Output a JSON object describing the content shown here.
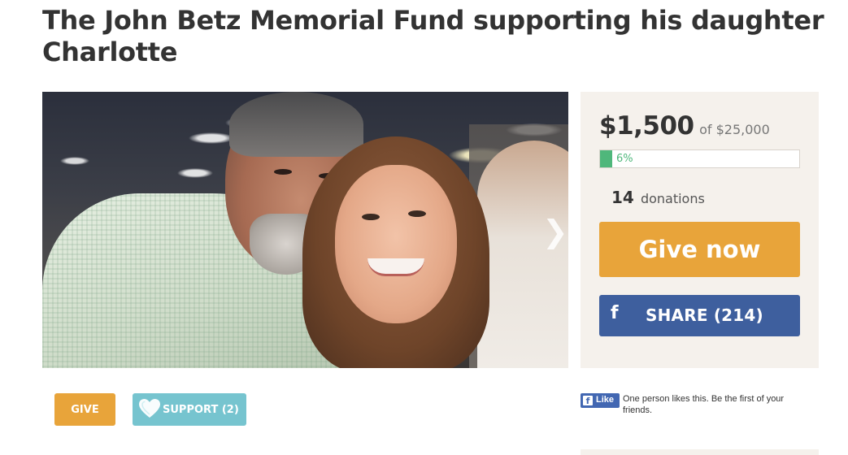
{
  "campaign": {
    "title": "The John Betz Memorial Fund supporting his daughter Charlotte"
  },
  "photo": {
    "next_arrow": "❯"
  },
  "donation_panel": {
    "raised": "$1,500",
    "goal": "of $25,000",
    "progress_percent": 6,
    "progress_label": "6%",
    "donations_count": "14",
    "donations_label": "donations",
    "give_now_label": "Give now",
    "share_icon": "f",
    "share_label": "SHARE (214)"
  },
  "actions": {
    "give_label": "GIVE",
    "support_label": "SUPPORT (2)"
  },
  "facebook": {
    "like_icon": "f",
    "like_label": "Like",
    "like_text": "One person likes this. Be the first of your friends."
  },
  "colors": {
    "accent_orange": "#e8a43a",
    "facebook_blue": "#3e5f9e",
    "support_teal": "#76c4cf",
    "progress_green": "#4fb77b",
    "panel_bg": "#f5f1ec"
  },
  "icons": {
    "next": "chevron-right-icon",
    "share": "facebook-icon",
    "support": "heart-icon"
  }
}
